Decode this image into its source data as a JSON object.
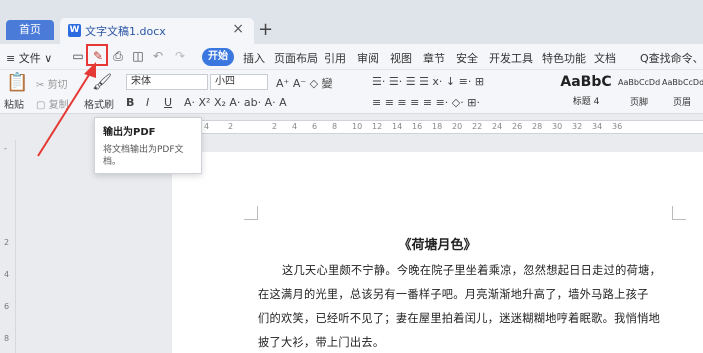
{
  "tabs": {
    "home": "首页",
    "doc": "文字文稿1.docx",
    "close": "×",
    "add": "+"
  },
  "menu": {
    "file": "≡ 文件 ∨",
    "start": "开始",
    "items": [
      "插入",
      "页面布局",
      "引用",
      "审阅",
      "视图",
      "章节",
      "安全",
      "开发工具",
      "特色功能",
      "文档"
    ],
    "search": "Q查找命令、搜"
  },
  "ribbon": {
    "paste": "粘贴",
    "cut": "剪切",
    "copy": "复制",
    "format_painter": "格式刷",
    "font": "宋体",
    "size": "小四",
    "styles": [
      {
        "sample": "AaBbC",
        "name": "标题 4"
      },
      {
        "sample": "AaBbCcDd",
        "name": "页脚"
      },
      {
        "sample": "AaBbCcDd",
        "name": "页眉"
      }
    ]
  },
  "ruler": {
    "ticks": [
      "4",
      "2",
      "2",
      "4",
      "6",
      "8",
      "10",
      "12",
      "14",
      "16",
      "18",
      "20",
      "22",
      "24",
      "26",
      "28",
      "30",
      "32",
      "34",
      "36"
    ],
    "vticks": [
      "-",
      "2",
      "4",
      "6",
      "8"
    ]
  },
  "tooltip": {
    "title": "输出为PDF",
    "desc": "将文档输出为PDF文档。"
  },
  "document": {
    "title": "《荷塘月色》",
    "lines": [
      "这几天心里颇不宁静。今晚在院子里坐着乘凉，忽然想起日日走过的荷塘，",
      "在这满月的光里，总该另有一番样子吧。月亮渐渐地升高了，墙外马路上孩子",
      "们的欢笑，已经听不见了；妻在屋里拍着闰儿，迷迷糊糊地哼着眠歌。我悄悄地",
      "披了大衫，带上门出去。"
    ]
  }
}
